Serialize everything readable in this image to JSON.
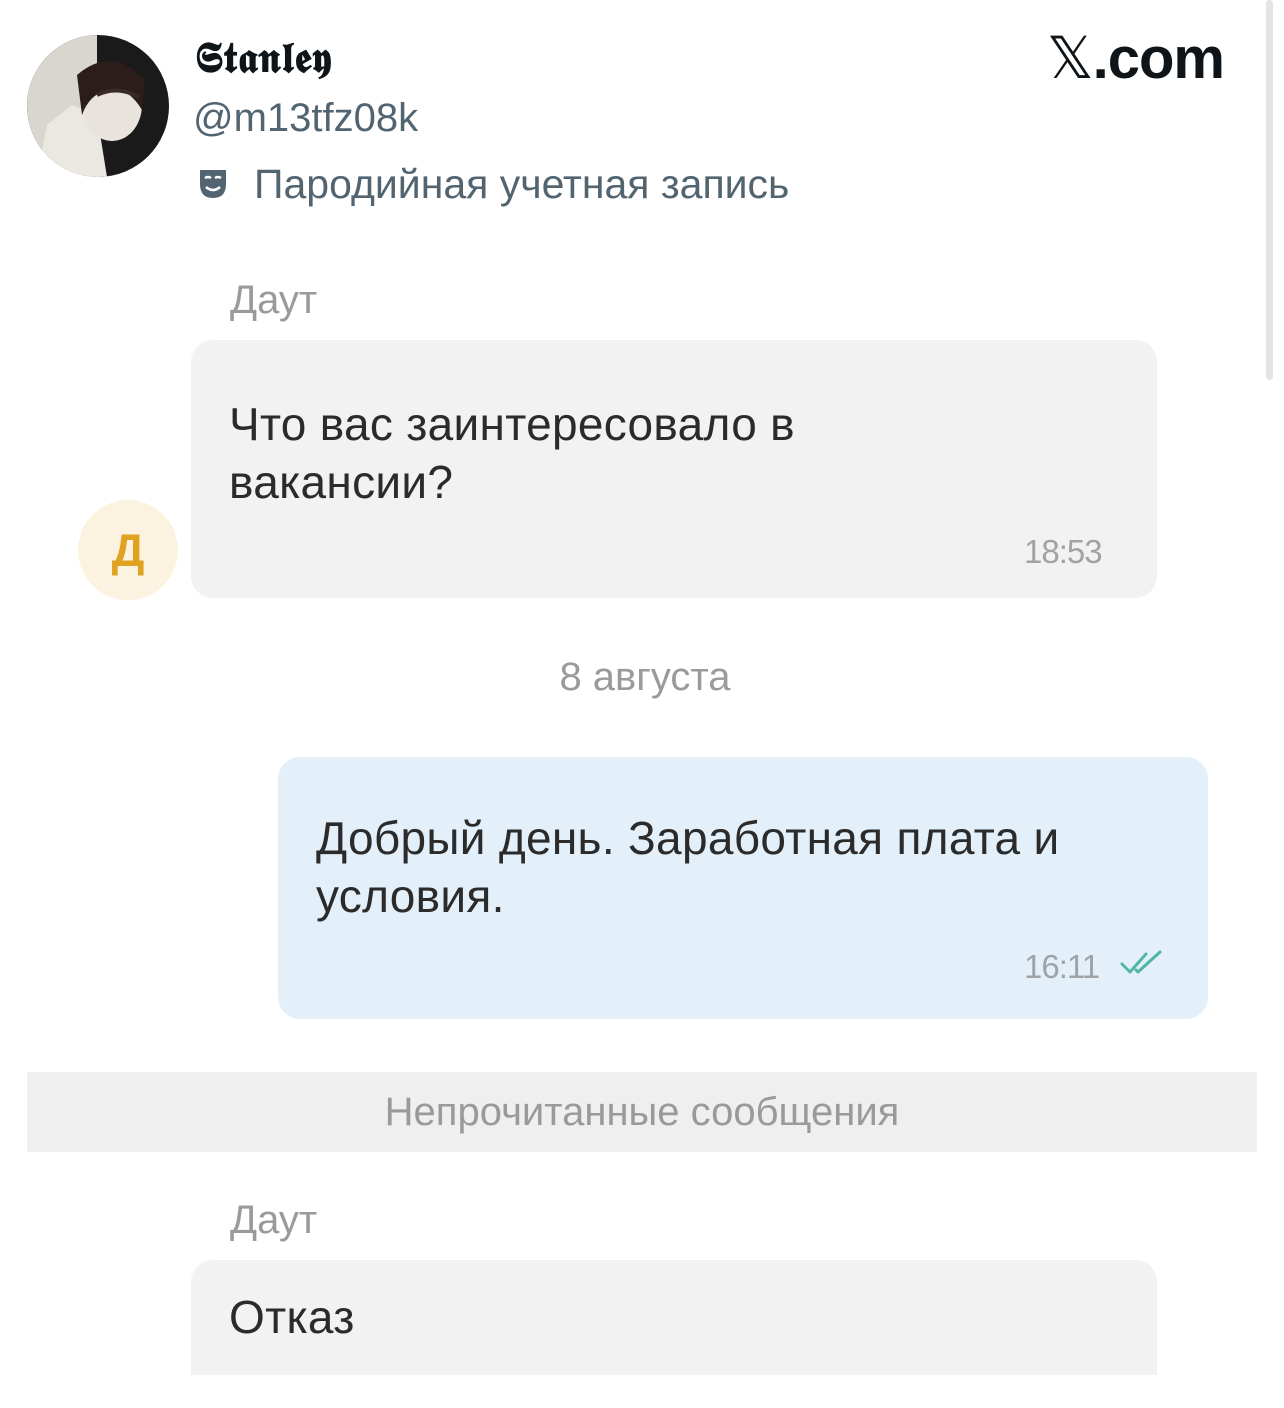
{
  "tweet": {
    "display_name": "𝕾𝖙𝖆𝖓𝖑𝖊𝖞",
    "handle": "@m13tfz08k",
    "parody_label": "Пародийная учетная запись",
    "brand_x": "𝕏",
    "brand_text": ".com",
    "avatar_icon": "user-avatar-photo",
    "parody_icon": "theater-mask-icon"
  },
  "chat": {
    "contact_initial": "Д",
    "accent_color": "#e0a321",
    "messages": [
      {
        "sender": "Даут",
        "text_line1": "Что вас заинтересовало в",
        "text_line2": "вакансии?",
        "time": "18:53",
        "direction": "incoming"
      },
      {
        "text_line1": "Добрый день. Заработная плата и",
        "text_line2": "условия.",
        "time": "16:11",
        "direction": "outgoing",
        "status_icon": "double-check-icon",
        "status_color": "#4fb6a0"
      },
      {
        "sender": "Даут",
        "text_line1": "Отказ",
        "direction": "incoming"
      }
    ],
    "date_separator": "8 августа",
    "unread_label": "Непрочитанные сообщения"
  }
}
